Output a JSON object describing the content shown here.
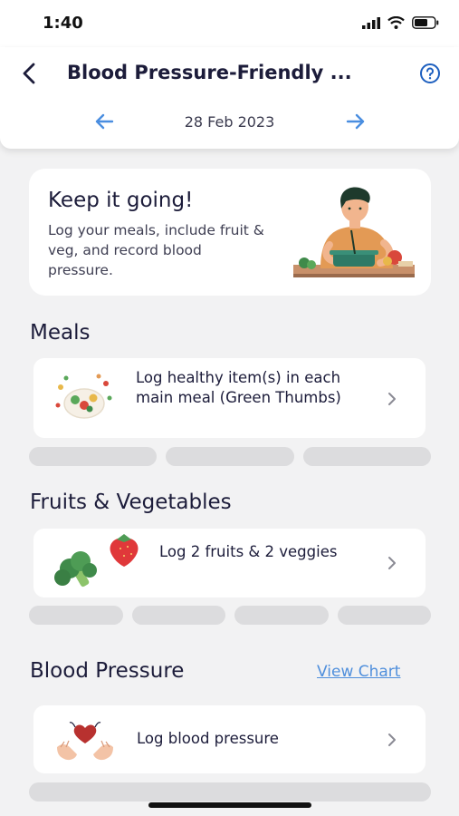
{
  "status_bar": {
    "time": "1:40"
  },
  "header": {
    "title": "Blood Pressure-Friendly ...",
    "date": "28 Feb 2023"
  },
  "hero": {
    "title": "Keep it going!",
    "body": "Log your meals, include fruit & veg, and record blood pressure."
  },
  "sections": {
    "meals": {
      "title": "Meals",
      "task_label": "Log healthy item(s) in each main meal (Green Thumbs)",
      "progress_slots": 3
    },
    "fruits_vegetables": {
      "title": "Fruits & Vegetables",
      "task_label": "Log 2 fruits & 2 veggies",
      "progress_slots": 4
    },
    "blood_pressure": {
      "title": "Blood Pressure",
      "link_label": "View Chart",
      "task_label": "Log blood pressure",
      "progress_slots": 1
    }
  },
  "icons": {
    "back": "chevron-left-icon",
    "help": "question-circle-icon",
    "date_prev": "arrow-left-icon",
    "date_next": "arrow-right-icon",
    "task": "chevron-right-icon"
  },
  "colors": {
    "accent": "#1d5fbf",
    "arrow": "#4a8ee0",
    "link": "#4f8fdc",
    "pill": "#dcdcde",
    "text": "#1c1c3a"
  }
}
